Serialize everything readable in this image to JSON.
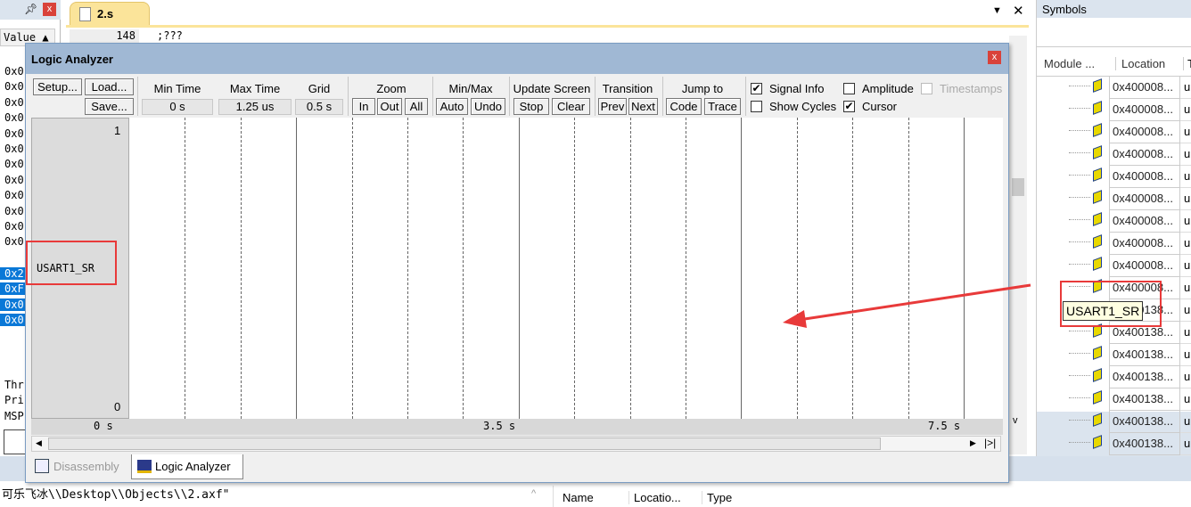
{
  "left_panel": {
    "column_header": "Value",
    "rows": [
      "0x0",
      "0x0",
      "0x0",
      "0x0",
      "0x0",
      "0x0",
      "0x0",
      "0x0",
      "0x0",
      "0x0",
      "0x0",
      "0x0"
    ],
    "selected_rows": [
      "0x2",
      "0xF",
      "0x0",
      "0x0"
    ],
    "bottom_rows": [
      "Thr",
      "Pri",
      "MSP"
    ]
  },
  "editor": {
    "tab": "2.s",
    "line_number": "148",
    "line_text": ";???"
  },
  "logic_analyzer": {
    "title": "Logic Analyzer",
    "buttons": {
      "setup": "Setup...",
      "load": "Load...",
      "save": "Save..."
    },
    "min_time": {
      "label": "Min Time",
      "value": "0 s"
    },
    "max_time": {
      "label": "Max Time",
      "value": "1.25 us"
    },
    "grid": {
      "label": "Grid",
      "value": "0.5 s"
    },
    "zoom": {
      "label": "Zoom",
      "in": "In",
      "out": "Out",
      "all": "All"
    },
    "minmax": {
      "label": "Min/Max",
      "auto": "Auto",
      "undo": "Undo"
    },
    "update": {
      "label": "Update Screen",
      "stop": "Stop",
      "clear": "Clear"
    },
    "transition": {
      "label": "Transition",
      "prev": "Prev",
      "next": "Next"
    },
    "jump": {
      "label": "Jump to",
      "code": "Code",
      "trace": "Trace"
    },
    "options": [
      {
        "label": "Signal Info",
        "checked": true
      },
      {
        "label": "Amplitude",
        "checked": false
      },
      {
        "label": "Timestamps",
        "checked": false,
        "disabled": true
      },
      {
        "label": "Show Cycles",
        "checked": false
      },
      {
        "label": "Cursor",
        "checked": true
      }
    ],
    "signal": {
      "name": "USART1_SR",
      "max": "1",
      "min": "0"
    },
    "time_axis": [
      "0 s",
      "3.5 s",
      "7.5 s"
    ],
    "highlight_color": "#e83a3a"
  },
  "bottom_tabs": [
    {
      "label": "Disassembly",
      "active": false
    },
    {
      "label": "Logic Analyzer",
      "active": true
    }
  ],
  "status_line": "可乐飞冰\\\\Desktop\\\\Objects\\\\2.axf\"",
  "bottom_right_columns": [
    "Name",
    "Locatio...",
    "Type"
  ],
  "symbols": {
    "title": "Symbols",
    "columns": [
      "Module ...",
      "Location",
      "T"
    ],
    "tooltip": "USART1_SR",
    "rows": [
      "0x400008...",
      "0x400008...",
      "0x400008...",
      "0x400008...",
      "0x400008...",
      "0x400008...",
      "0x400008...",
      "0x400008...",
      "0x400008...",
      "0x400008...",
      "0x400138...",
      "0x400138...",
      "0x400138...",
      "0x400138...",
      "0x400138...",
      "0x400138...",
      "0x400138..."
    ],
    "type_prefix": "u"
  }
}
